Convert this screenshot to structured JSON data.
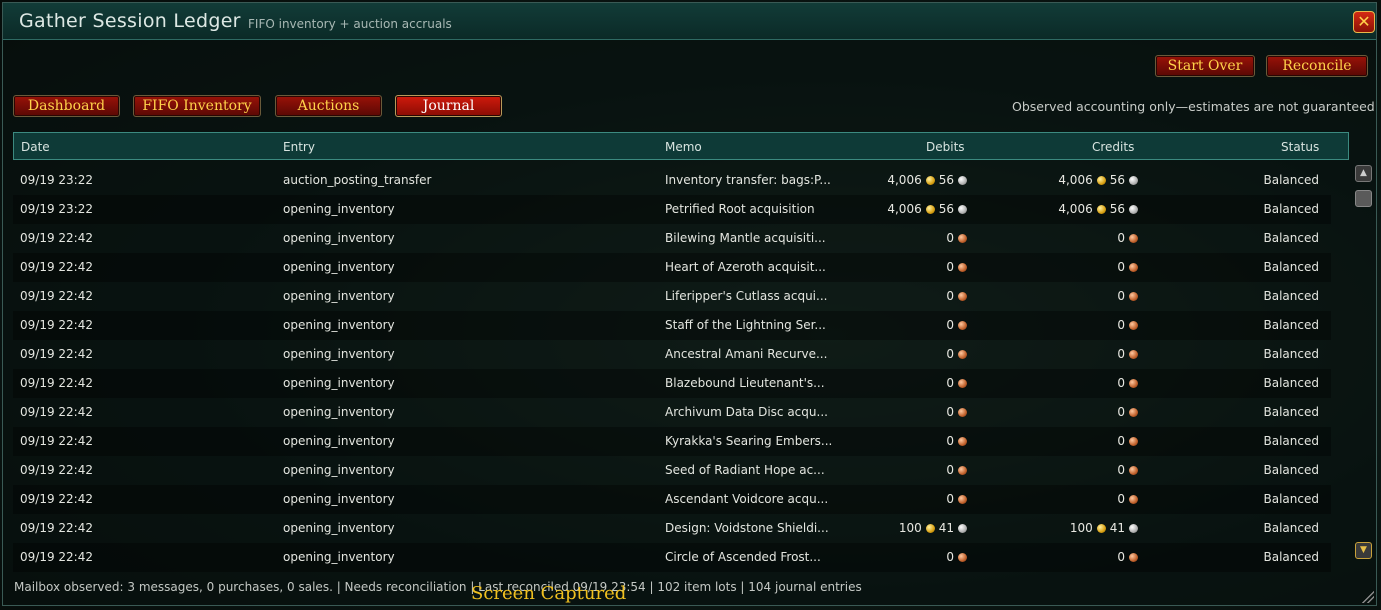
{
  "window": {
    "title": "Gather Session Ledger",
    "subtitle": "FIFO inventory + auction accruals",
    "close_label": "✕"
  },
  "actions": {
    "start_over": "Start Over",
    "reconcile": "Reconcile"
  },
  "tabs": [
    {
      "label": "Dashboard",
      "active": false
    },
    {
      "label": "FIFO Inventory",
      "active": false
    },
    {
      "label": "Auctions",
      "active": false
    },
    {
      "label": "Journal",
      "active": true
    }
  ],
  "notice": "Observed accounting only—estimates are not guaranteed",
  "columns": {
    "date": "Date",
    "entry": "Entry",
    "memo": "Memo",
    "debits": "Debits",
    "credits": "Credits",
    "status": "Status"
  },
  "rows": [
    {
      "date": "09/19 23:22",
      "entry": "auction_posting_transfer",
      "memo": "Inventory transfer: bags:P...",
      "debit": {
        "gold": "4,006",
        "silver": "56"
      },
      "credit": {
        "gold": "4,006",
        "silver": "56"
      },
      "status": "Balanced"
    },
    {
      "date": "09/19 23:22",
      "entry": "opening_inventory",
      "memo": "Petrified Root acquisition",
      "debit": {
        "gold": "4,006",
        "silver": "56"
      },
      "credit": {
        "gold": "4,006",
        "silver": "56"
      },
      "status": "Balanced"
    },
    {
      "date": "09/19 22:42",
      "entry": "opening_inventory",
      "memo": "Bilewing Mantle acquisiti...",
      "debit": {
        "copper": "0"
      },
      "credit": {
        "copper": "0"
      },
      "status": "Balanced"
    },
    {
      "date": "09/19 22:42",
      "entry": "opening_inventory",
      "memo": "Heart of Azeroth acquisit...",
      "debit": {
        "copper": "0"
      },
      "credit": {
        "copper": "0"
      },
      "status": "Balanced"
    },
    {
      "date": "09/19 22:42",
      "entry": "opening_inventory",
      "memo": "Liferipper's Cutlass acqui...",
      "debit": {
        "copper": "0"
      },
      "credit": {
        "copper": "0"
      },
      "status": "Balanced"
    },
    {
      "date": "09/19 22:42",
      "entry": "opening_inventory",
      "memo": "Staff of the Lightning Ser...",
      "debit": {
        "copper": "0"
      },
      "credit": {
        "copper": "0"
      },
      "status": "Balanced"
    },
    {
      "date": "09/19 22:42",
      "entry": "opening_inventory",
      "memo": "Ancestral Amani Recurve...",
      "debit": {
        "copper": "0"
      },
      "credit": {
        "copper": "0"
      },
      "status": "Balanced"
    },
    {
      "date": "09/19 22:42",
      "entry": "opening_inventory",
      "memo": "Blazebound Lieutenant's...",
      "debit": {
        "copper": "0"
      },
      "credit": {
        "copper": "0"
      },
      "status": "Balanced"
    },
    {
      "date": "09/19 22:42",
      "entry": "opening_inventory",
      "memo": "Archivum Data Disc acqu...",
      "debit": {
        "copper": "0"
      },
      "credit": {
        "copper": "0"
      },
      "status": "Balanced"
    },
    {
      "date": "09/19 22:42",
      "entry": "opening_inventory",
      "memo": "Kyrakka's Searing Embers...",
      "debit": {
        "copper": "0"
      },
      "credit": {
        "copper": "0"
      },
      "status": "Balanced"
    },
    {
      "date": "09/19 22:42",
      "entry": "opening_inventory",
      "memo": "Seed of Radiant Hope ac...",
      "debit": {
        "copper": "0"
      },
      "credit": {
        "copper": "0"
      },
      "status": "Balanced"
    },
    {
      "date": "09/19 22:42",
      "entry": "opening_inventory",
      "memo": "Ascendant Voidcore acqu...",
      "debit": {
        "copper": "0"
      },
      "credit": {
        "copper": "0"
      },
      "status": "Balanced"
    },
    {
      "date": "09/19 22:42",
      "entry": "opening_inventory",
      "memo": "Design: Voidstone Shieldi...",
      "debit": {
        "gold": "100",
        "silver": "41"
      },
      "credit": {
        "gold": "100",
        "silver": "41"
      },
      "status": "Balanced"
    },
    {
      "date": "09/19 22:42",
      "entry": "opening_inventory",
      "memo": "Circle of Ascended Frost...",
      "debit": {
        "copper": "0"
      },
      "credit": {
        "copper": "0"
      },
      "status": "Balanced"
    }
  ],
  "footer": "Mailbox observed: 3 messages, 0 purchases, 0 sales.  |  Needs reconciliation  |  Last reconciled 09/19 23:54  |  102 item lots  |  104 journal entries",
  "overlay": "Screen Captured",
  "colors": {
    "accent_red": "#9a1208",
    "header_teal": "#0e3a37",
    "gold_text": "#ffd24a"
  }
}
